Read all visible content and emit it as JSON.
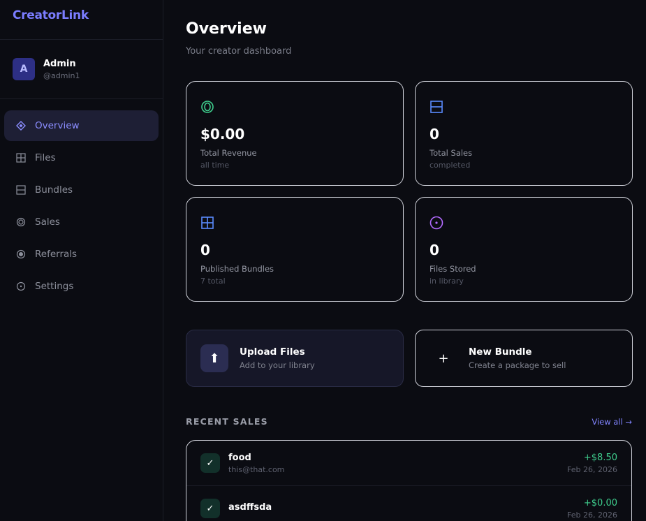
{
  "app": {
    "brand": "CreatorLink"
  },
  "user": {
    "initial": "A",
    "name": "Admin",
    "handle": "@admin1"
  },
  "nav": [
    {
      "label": "Overview",
      "icon": "diamond-icon",
      "active": true
    },
    {
      "label": "Files",
      "icon": "grid-icon"
    },
    {
      "label": "Bundles",
      "icon": "bundle-icon"
    },
    {
      "label": "Sales",
      "icon": "ring-icon"
    },
    {
      "label": "Referrals",
      "icon": "dot-circle-icon"
    },
    {
      "label": "Settings",
      "icon": "settings-circle-icon"
    }
  ],
  "page": {
    "title": "Overview",
    "subtitle": "Your creator dashboard"
  },
  "stats": [
    {
      "value": "$0.00",
      "label": "Total Revenue",
      "sub": "all time",
      "icon": "revenue-ring-icon",
      "color": "#3fcf8e"
    },
    {
      "value": "0",
      "label": "Total Sales",
      "sub": "completed",
      "icon": "sales-box-icon",
      "color": "#5b8cff"
    },
    {
      "value": "0",
      "label": "Published Bundles",
      "sub": "7 total",
      "icon": "bundles-grid-icon",
      "color": "#5b8cff"
    },
    {
      "value": "0",
      "label": "Files Stored",
      "sub": "in library",
      "icon": "files-circle-icon",
      "color": "#b36bff"
    }
  ],
  "actions": {
    "upload": {
      "title": "Upload Files",
      "sub": "Add to your library",
      "glyph": "⬆"
    },
    "bundle": {
      "title": "New Bundle",
      "sub": "Create a package to sell",
      "glyph": "+"
    }
  },
  "recent_sales": {
    "title": "RECENT SALES",
    "view_all": "View all →",
    "rows": [
      {
        "name": "food",
        "email": "this@that.com",
        "amount": "+$8.50",
        "date": "Feb 26, 2026"
      },
      {
        "name": "asdffsda",
        "email": "",
        "amount": "+$0.00",
        "date": "Feb 26, 2026"
      }
    ]
  },
  "colors": {
    "accent": "#7b7dff",
    "positive": "#3fcf8e",
    "background": "#0b0c12"
  }
}
